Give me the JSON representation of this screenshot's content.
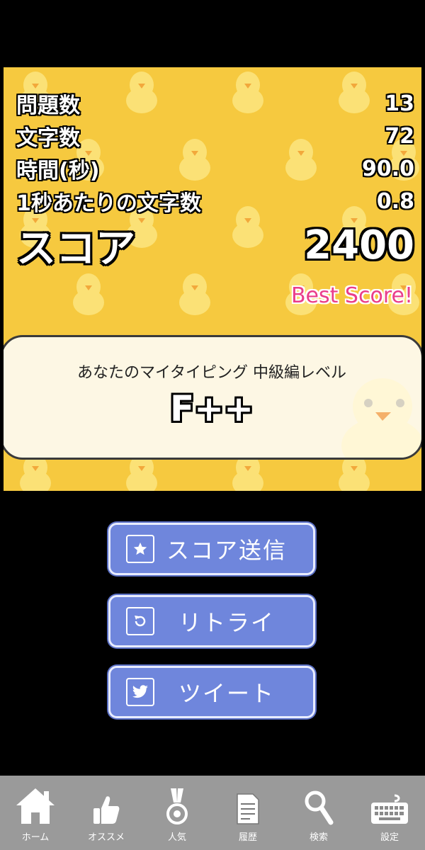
{
  "stats": [
    {
      "label": "問題数",
      "value": "13"
    },
    {
      "label": "文字数",
      "value": "72"
    },
    {
      "label": "時間(秒)",
      "value": "90.0"
    },
    {
      "label": "1秒あたりの文字数",
      "value": "0.8"
    }
  ],
  "score": {
    "label": "スコア",
    "value": "2400"
  },
  "best_score": "Best Score!",
  "level": {
    "label": "あなたのマイタイピング  中級編レベル",
    "rank": "F++"
  },
  "buttons": {
    "send_score": "スコア送信",
    "retry": "リトライ",
    "tweet": "ツイート"
  },
  "nav": {
    "home": "ホーム",
    "recommend": "オススメ",
    "popular": "人気",
    "history": "履歴",
    "search": "検索",
    "settings": "設定"
  },
  "colors": {
    "panel_bg": "#f6c93f",
    "button_bg": "#6f86dc",
    "best_score": "#ea3d8a",
    "nav_bg": "#9a9a9a"
  }
}
